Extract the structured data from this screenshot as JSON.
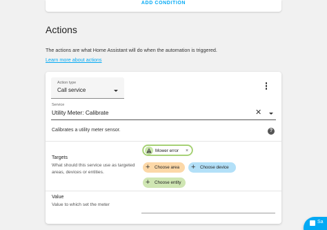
{
  "conditions": {
    "add_label": "ADD CONDITION"
  },
  "actions": {
    "title": "Actions",
    "description": "The actions are what Home Assistant will do when the automation is triggered.",
    "learn_more": "Learn more about actions"
  },
  "action_card": {
    "action_type": {
      "label": "Action type",
      "value": "Call service"
    },
    "more_icon": "dots-vertical-icon",
    "service": {
      "label": "Service",
      "value": "Utility Meter: Calibrate",
      "clear_icon": "close-icon",
      "dropdown_icon": "chevron-down-icon"
    },
    "service_description": "Calibrates a utility meter sensor.",
    "help_icon": "question-circle-icon",
    "targets": {
      "title": "Targets",
      "description": "What should this service use as targeted areas, devices or entities.",
      "selected": [
        {
          "label": "Mower error",
          "icon": "warning-icon",
          "remove_label": "×"
        }
      ],
      "choose_area": "Choose area",
      "choose_device": "Choose device",
      "choose_entity": "Choose entity",
      "add_icon": "+"
    },
    "value": {
      "title": "Value",
      "description": "Value to which set the meter",
      "input_value": ""
    }
  },
  "fab": {
    "label": "Sa",
    "icon": "save-icon"
  },
  "colors": {
    "accent": "#03a9f4",
    "area_chip": "#fcd8a8",
    "device_chip": "#b3e0f8",
    "entity_chip": "#cfe6b3"
  }
}
